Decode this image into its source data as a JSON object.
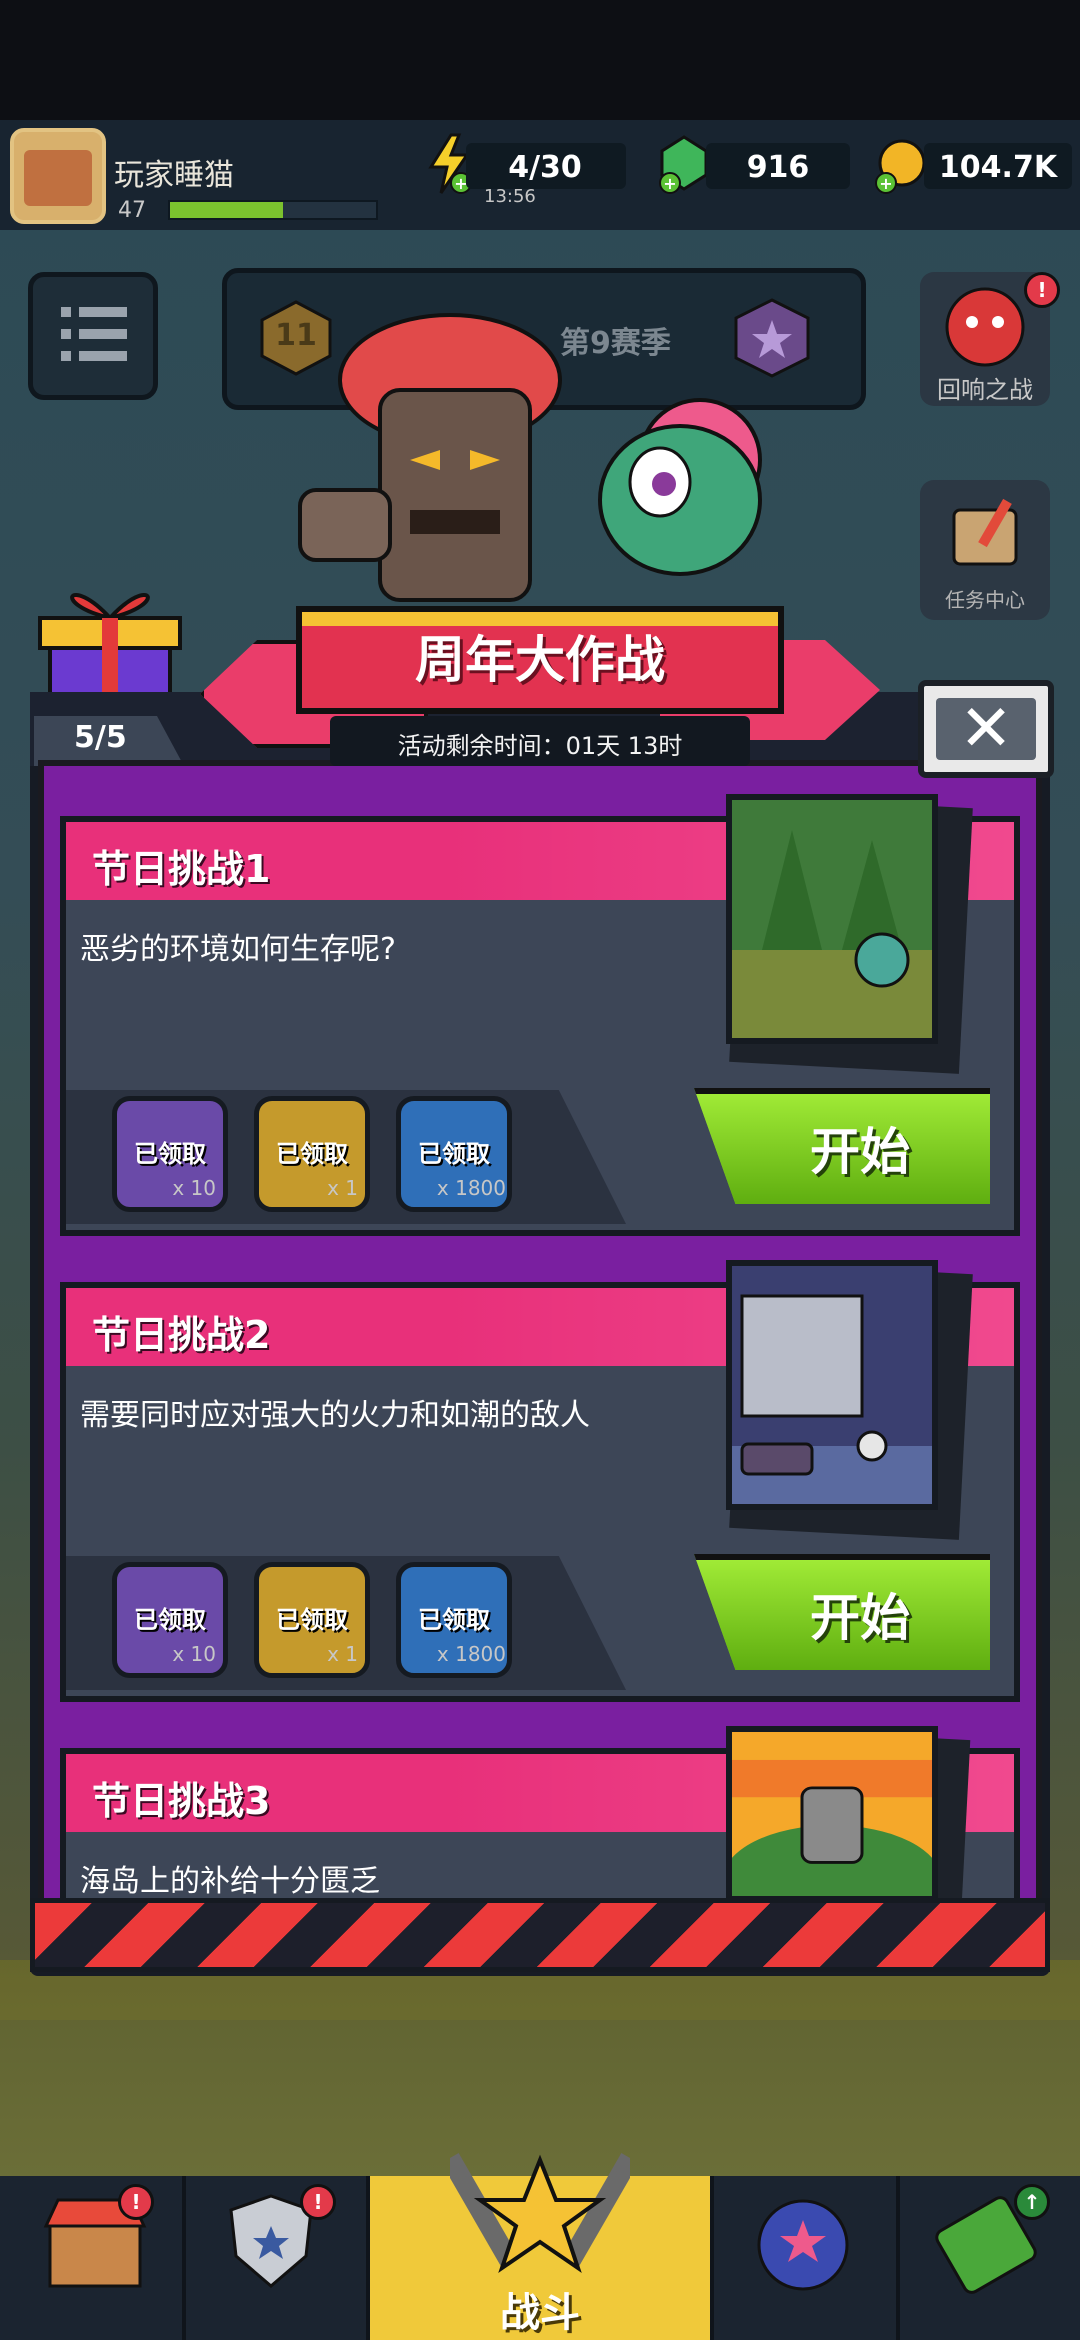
{
  "player": {
    "name": "玩家睡猫",
    "level": "47",
    "xp_fraction": 0.55
  },
  "resources": {
    "energy": "4/30",
    "energy_timer": "13:56",
    "gems": "916",
    "coins": "104.7K"
  },
  "season": {
    "level": "11",
    "label": "第9赛季"
  },
  "side_buttons": {
    "echo_battle": "回响之战",
    "task_center": "任务中心"
  },
  "event": {
    "title": "周年大作战",
    "remaining_time": "活动剩余时间：01天 13时",
    "counter": "5/5",
    "close_icon": "✕"
  },
  "challenges": [
    {
      "title": "节日挑战1",
      "description": "恶劣的环境如何生存呢?",
      "start_label": "开始",
      "rewards": [
        {
          "label": "已领取",
          "qty": "x 10",
          "color": "#6a4aa8"
        },
        {
          "label": "已领取",
          "qty": "x 1",
          "color": "#c59a2c"
        },
        {
          "label": "已领取",
          "qty": "x 1800",
          "color": "#2f6fb8"
        }
      ]
    },
    {
      "title": "节日挑战2",
      "description": "需要同时应对强大的火力和如潮的敌人",
      "start_label": "开始",
      "rewards": [
        {
          "label": "已领取",
          "qty": "x 10",
          "color": "#6a4aa8"
        },
        {
          "label": "已领取",
          "qty": "x 1",
          "color": "#c59a2c"
        },
        {
          "label": "已领取",
          "qty": "x 1800",
          "color": "#2f6fb8"
        }
      ]
    },
    {
      "title": "节日挑战3",
      "description": "海岛上的补给十分匮乏"
    }
  ],
  "nav": {
    "battle_label": "战斗"
  },
  "colors": {
    "accent_pink": "#e8307a",
    "start_green": "#84d51f",
    "modal_purple": "#7a1fa0"
  }
}
